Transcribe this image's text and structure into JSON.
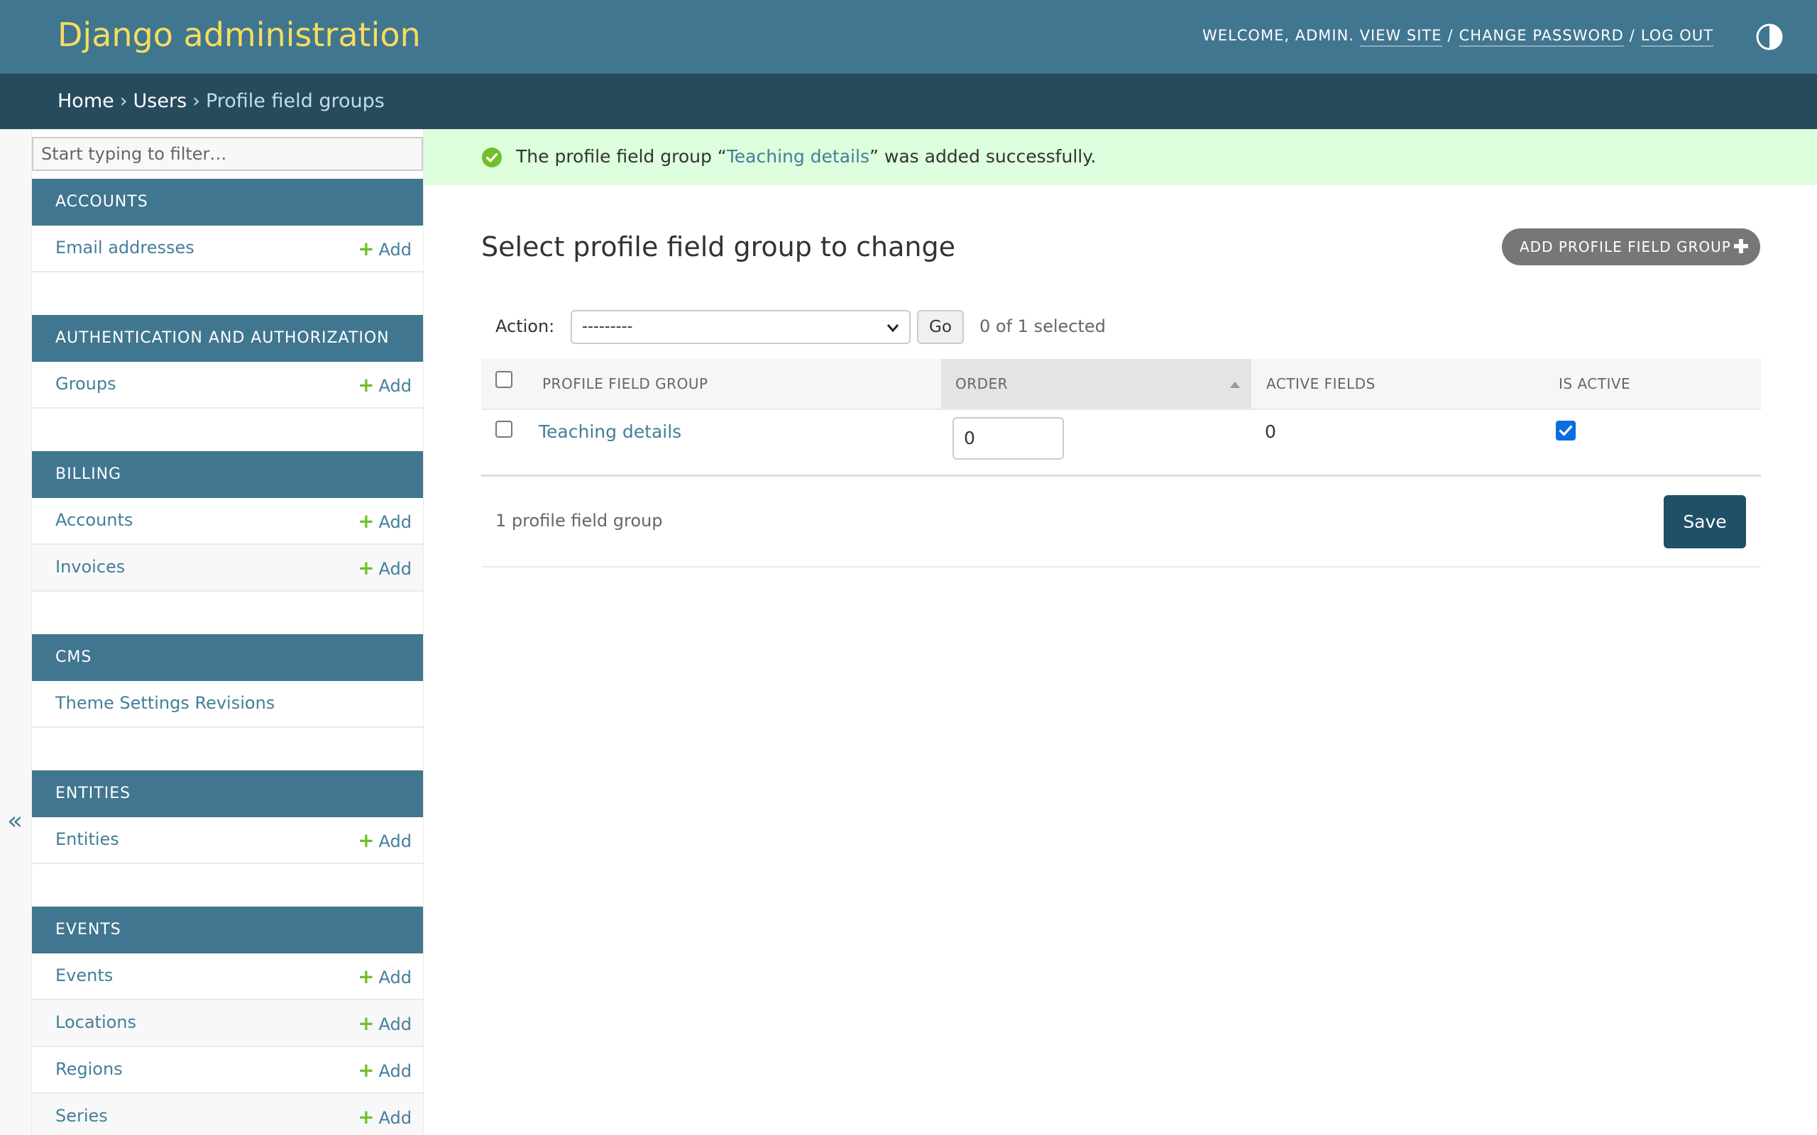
{
  "header": {
    "site_title": "Django administration",
    "welcome": "Welcome,",
    "username": "admin.",
    "view_site": "View site",
    "change_password": "Change password",
    "log_out": "Log out",
    "separator": "/",
    "theme_toggle_icon": "half-circle-contrast-icon"
  },
  "breadcrumbs": {
    "home": "Home",
    "users": "Users",
    "current": "Profile field groups",
    "separator": "›"
  },
  "sidebar": {
    "toggle_glyph": "«",
    "filter_placeholder": "Start typing to filter…",
    "add_label": "Add",
    "modules": [
      {
        "caption": "Accounts",
        "models": [
          {
            "name": "Email addresses",
            "has_add": true
          }
        ]
      },
      {
        "caption": "Authentication and Authorization",
        "models": [
          {
            "name": "Groups",
            "has_add": true
          }
        ]
      },
      {
        "caption": "Billing",
        "models": [
          {
            "name": "Accounts",
            "has_add": true
          },
          {
            "name": "Invoices",
            "has_add": true
          }
        ]
      },
      {
        "caption": "CMS",
        "models": [
          {
            "name": "Theme Settings Revisions",
            "has_add": false
          }
        ]
      },
      {
        "caption": "Entities",
        "models": [
          {
            "name": "Entities",
            "has_add": true
          }
        ]
      },
      {
        "caption": "Events",
        "models": [
          {
            "name": "Events",
            "has_add": true
          },
          {
            "name": "Locations",
            "has_add": true
          },
          {
            "name": "Regions",
            "has_add": true
          },
          {
            "name": "Series",
            "has_add": true
          }
        ]
      }
    ]
  },
  "message": {
    "prefix": "The profile field group “",
    "link": "Teaching details",
    "suffix": "” was added successfully.",
    "icon": "check-circle-icon",
    "color": "#70bf2b"
  },
  "content": {
    "title": "Select profile field group to change",
    "add_button": "Add profile field group"
  },
  "actions": {
    "label": "Action:",
    "selected_option": "---------",
    "go": "Go",
    "selected_count": "0 of 1 selected"
  },
  "table": {
    "headers": {
      "name": "Profile field group",
      "order": "Order",
      "active_fields": "Active fields",
      "is_active": "Is active"
    },
    "rows": [
      {
        "name": "Teaching details",
        "order": "0",
        "active_fields": "0",
        "is_active": true
      }
    ]
  },
  "paginator": {
    "count": "1 profile field group",
    "save": "Save"
  },
  "colors": {
    "header": "#417690",
    "breadcrumbs": "#264b5d",
    "branding": "#f5dd5d",
    "link": "#447e9b",
    "add_plus": "#70bf2b",
    "message_bg": "#ddffdd",
    "save_button": "#205067"
  }
}
